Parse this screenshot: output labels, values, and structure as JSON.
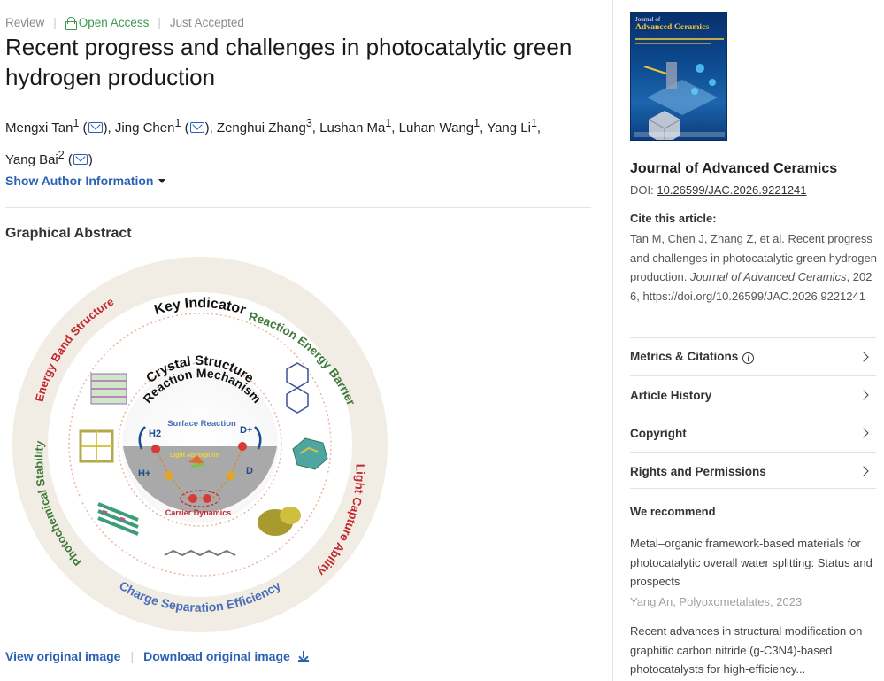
{
  "article": {
    "type": "Review",
    "access": "Open Access",
    "status": "Just Accepted",
    "title": "Recent progress and challenges in photocatalytic green hydrogen production",
    "authors": [
      {
        "name": "Mengxi Tan",
        "sup": "1",
        "email": true
      },
      {
        "name": "Jing Chen",
        "sup": "1",
        "email": true
      },
      {
        "name": "Zenghui Zhang",
        "sup": "3",
        "email": false
      },
      {
        "name": "Lushan Ma",
        "sup": "1",
        "email": false
      },
      {
        "name": "Luhan Wang",
        "sup": "1",
        "email": false
      },
      {
        "name": "Yang Li",
        "sup": "1",
        "email": false
      },
      {
        "name": "Yang Bai",
        "sup": "2",
        "email": true
      }
    ],
    "show_author_info": "Show Author Information"
  },
  "graphical_abstract": {
    "heading": "Graphical Abstract",
    "outer_ring_labels": [
      "Key Indicator",
      "Reaction Energy Barrier",
      "Light Capture Ability",
      "Charge Separation Efficiency",
      "Photochemical Stability",
      "Energy Band Structure"
    ],
    "middle_ring_label": "Crystal Structure",
    "inner_ring_label": "Reaction Mechanism",
    "center_labels": {
      "surface": "Surface Reaction",
      "h2": "H2",
      "dplus": "D+",
      "hplus": "H+",
      "d": "D",
      "light": "Light Absorption",
      "carrier": "Carrier Dynamics"
    },
    "view_link": "View original image",
    "download_link": "Download original image"
  },
  "sidebar": {
    "cover": {
      "journal_word": "Journal of",
      "journal_name": "Advanced Ceramics"
    },
    "journal_name": "Journal of Advanced Ceramics",
    "doi_label": "DOI:",
    "doi": "10.26599/JAC.2026.9221241",
    "cite_heading": "Cite this article:",
    "cite_prefix": "Tan M, Chen J, Zhang Z, et al. Recent progress and challenges in photocatalytic green hydrogen production.",
    "cite_journal": "Journal of Advanced Ceramics",
    "cite_suffix": ", 2026, https://doi.org/10.26599/JAC.2026.9221241",
    "accordions": [
      "Metrics & Citations",
      "Article History",
      "Copyright",
      "Rights and Permissions"
    ],
    "recommend_heading": "We recommend",
    "recommendations": [
      {
        "title": "Metal–organic framework-based materials for photocatalytic overall water splitting: Status and prospects",
        "meta": "Yang An, Polyoxometalates, 2023"
      },
      {
        "title": "Recent advances in structural modification on graphitic carbon nitride (g-C3N4)-based photocatalysts for high-efficiency...",
        "meta": ""
      }
    ]
  },
  "colors": {
    "link": "#2b61b4",
    "open_access": "#3d9b4c",
    "ring_red": "#c3282f",
    "ring_green": "#3f7a3a",
    "ring_blue": "#4a6fb8"
  }
}
